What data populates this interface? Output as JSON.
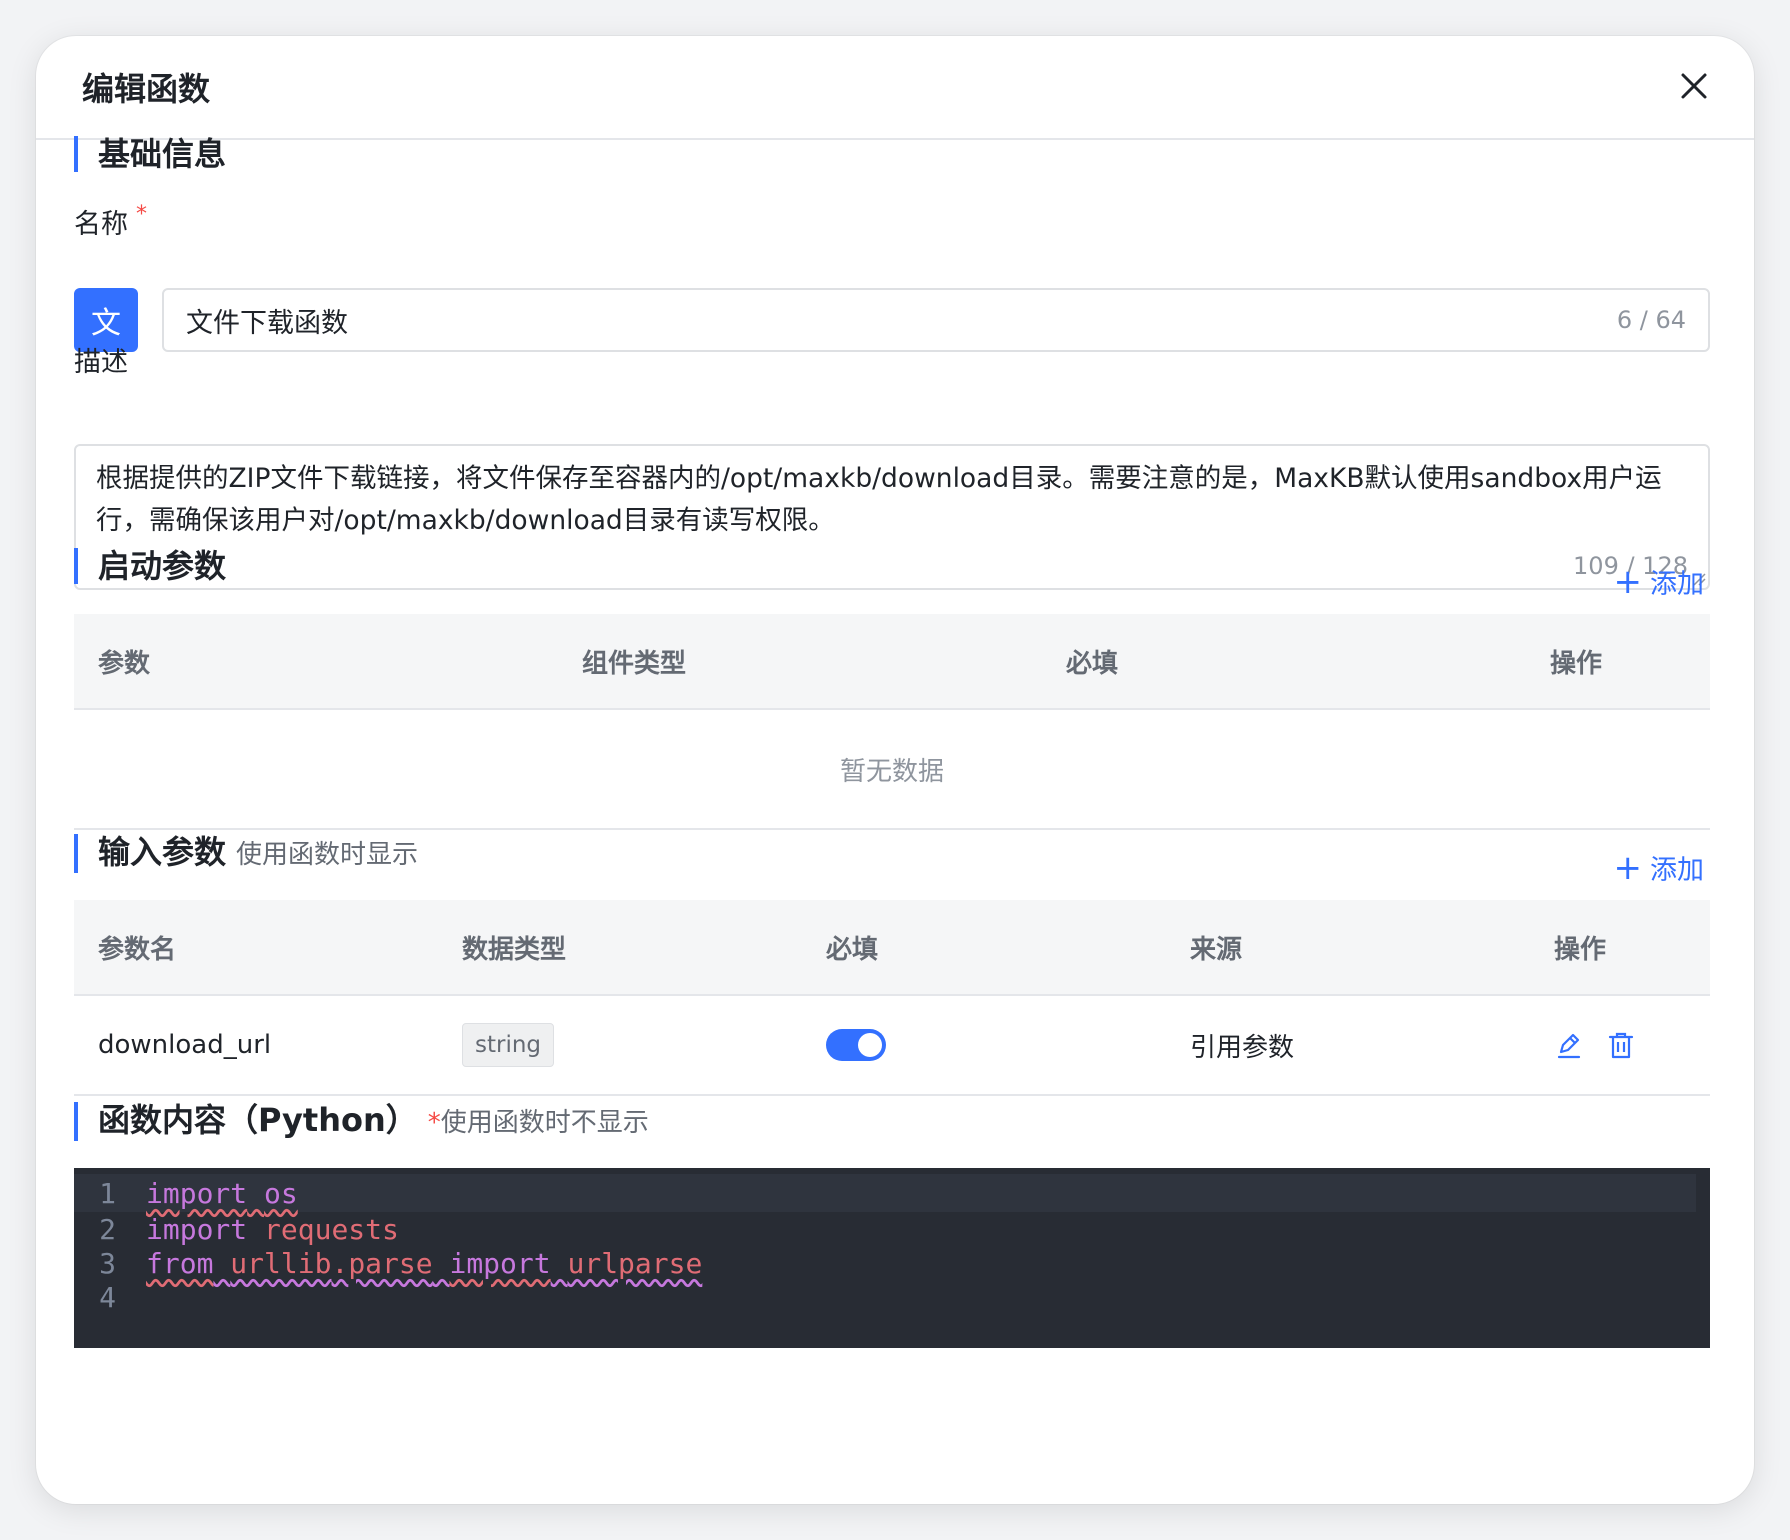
{
  "dialog": {
    "title": "编辑函数"
  },
  "basic": {
    "section_title": "基础信息",
    "name_label": "名称",
    "required_mark": "*",
    "avatar_text": "文",
    "name_value": "文件下载函数",
    "name_count": "6 / 64",
    "desc_label": "描述",
    "desc_value": "根据提供的ZIP文件下载链接，将文件保存至容器内的/opt/maxkb/download目录。需要注意的是，MaxKB默认使用sandbox用户运行，需确保该用户对/opt/maxkb/download目录有读写权限。",
    "desc_count": "109 / 128"
  },
  "startup_params": {
    "section_title": "启动参数",
    "add_label": "添加",
    "columns": [
      "参数",
      "组件类型",
      "必填",
      "操作"
    ],
    "empty_text": "暂无数据"
  },
  "input_params": {
    "section_title": "输入参数",
    "subtitle": "使用函数时显示",
    "add_label": "添加",
    "columns": [
      "参数名",
      "数据类型",
      "必填",
      "来源",
      "操作"
    ],
    "rows": [
      {
        "name": "download_url",
        "type": "string",
        "required": true,
        "source": "引用参数"
      }
    ]
  },
  "code_section": {
    "section_title": "函数内容（Python）",
    "required_mark": "*",
    "subtitle": "使用函数时不显示",
    "line_numbers": [
      "1",
      "2",
      "3",
      "4"
    ],
    "tokens": {
      "import": "import",
      "os": "os",
      "requests": "requests",
      "from": "from",
      "urllib": "urllib",
      "dot": ".",
      "parse": "parse",
      "urlparse": "urlparse"
    }
  },
  "colors": {
    "accent": "#3370ff",
    "danger": "#f54a45",
    "code_bg": "#282c34"
  },
  "icons": {
    "close": "close-icon",
    "plus": "plus-icon",
    "edit": "edit-icon",
    "delete": "trash-icon"
  }
}
